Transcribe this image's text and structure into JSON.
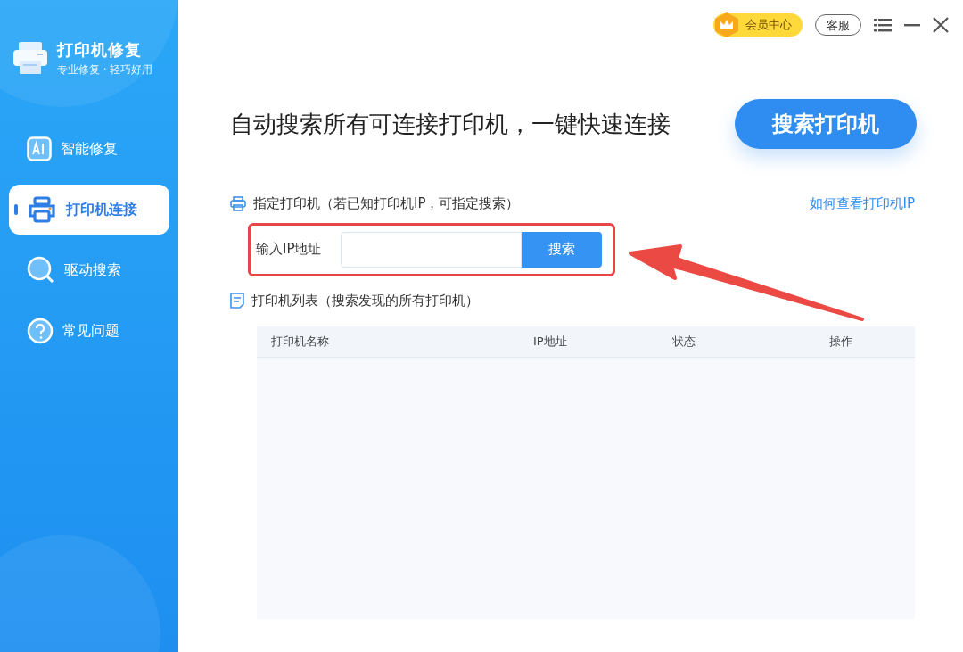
{
  "app": {
    "title": "打印机修复",
    "subtitle": "专业修复 · 轻巧好用"
  },
  "nav": [
    {
      "label": "智能修复",
      "selected": false
    },
    {
      "label": "打印机连接",
      "selected": true
    },
    {
      "label": "驱动搜索",
      "selected": false
    },
    {
      "label": "常见问题",
      "selected": false
    }
  ],
  "top_bar": {
    "member": "会员中心",
    "service": "客服"
  },
  "headline": "自动搜索所有可连接打印机，一键快速连接",
  "search_printer_button": "搜索打印机",
  "specify": {
    "title": "指定打印机（若已知打印机IP，可指定搜索）",
    "help_link": "如何查看打印机IP",
    "ip_label": "输入IP地址",
    "search_button": "搜索"
  },
  "list": {
    "title": "打印机列表（搜索发现的所有打印机）",
    "columns": [
      "打印机名称",
      "IP地址",
      "状态",
      "操作"
    ]
  }
}
